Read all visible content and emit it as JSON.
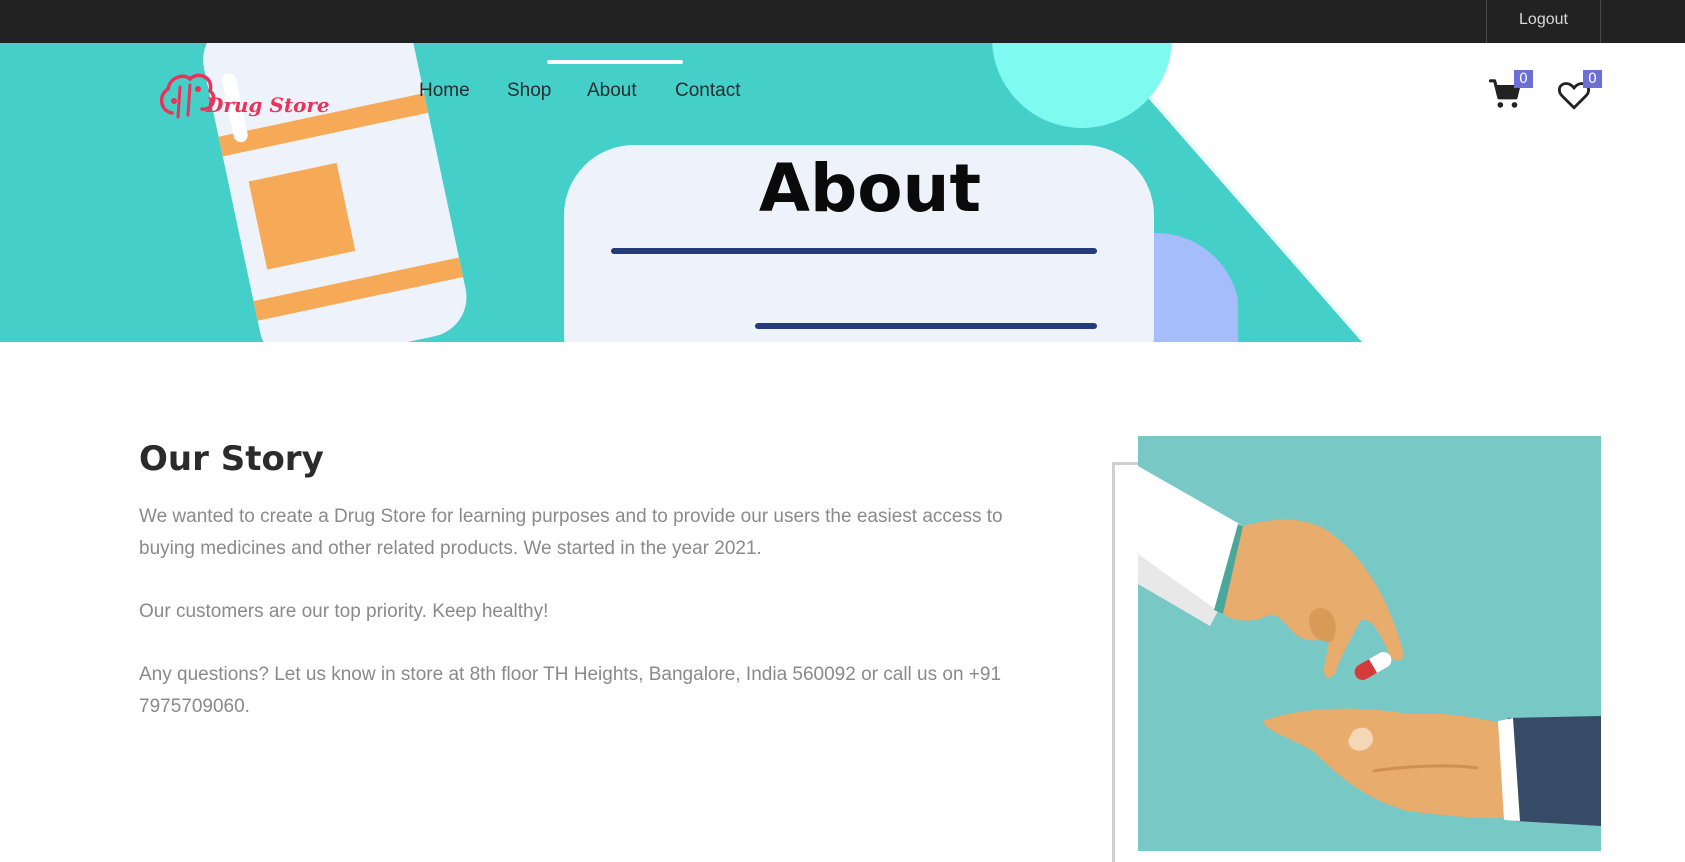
{
  "topbar": {
    "logout_label": "Logout"
  },
  "brand": {
    "name": "Drug Store"
  },
  "nav": {
    "items": [
      "Home",
      "Shop",
      "About",
      "Contact"
    ],
    "active": "About"
  },
  "header_icons": {
    "cart_count": "0",
    "favorites_count": "0"
  },
  "hero": {
    "title": "About"
  },
  "story": {
    "title": "Our Story",
    "paragraphs": [
      "We wanted to create a Drug Store for learning purposes and to provide our users the easiest access to buying medicines and other related products. We started in the year 2021.",
      "Our customers are our top priority. Keep healthy!",
      "Any questions? Let us know in store at 8th floor TH Heights, Bangalore, India 560092 or call us on +91 7975709060."
    ]
  },
  "colors": {
    "topbar": "#222222",
    "hero_teal": "#45cfc9",
    "accent_badge": "#6c6fd6",
    "brand_pink": "#e8345a",
    "image_bg": "#78c8c6"
  }
}
